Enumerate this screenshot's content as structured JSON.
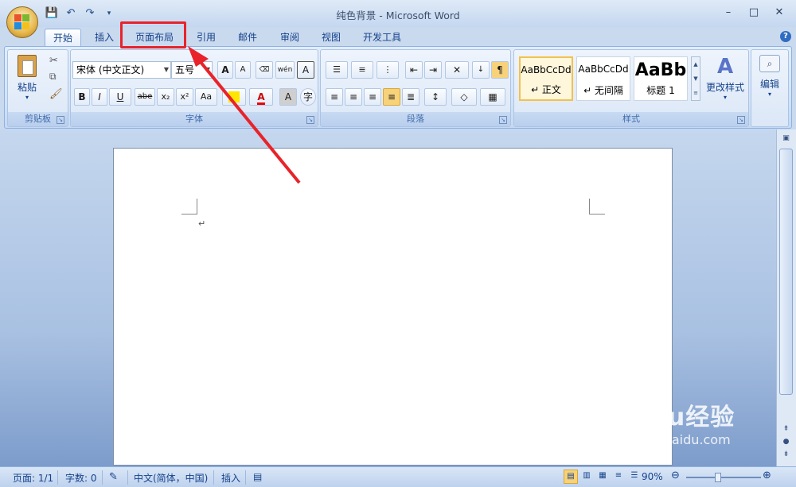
{
  "window": {
    "title": "纯色背景 - Microsoft Word",
    "controls": [
      "–",
      "□",
      "✕"
    ]
  },
  "tabs": [
    {
      "label": "开始",
      "active": true
    },
    {
      "label": "插入",
      "active": false
    },
    {
      "label": "页面布局",
      "active": false,
      "highlighted": true
    },
    {
      "label": "引用",
      "active": false
    },
    {
      "label": "邮件",
      "active": false
    },
    {
      "label": "审阅",
      "active": false
    },
    {
      "label": "视图",
      "active": false
    },
    {
      "label": "开发工具",
      "active": false
    }
  ],
  "ribbon": {
    "clipboard": {
      "label": "剪贴板",
      "paste_label": "粘贴"
    },
    "font": {
      "label": "字体",
      "font_name": "宋体 (中文正文)",
      "font_size": "五号",
      "format_buttons": [
        "B",
        "I",
        "U",
        "abe",
        "x₂",
        "x²",
        "Aa"
      ],
      "big_labels": [
        "A",
        "A",
        "wén",
        "A"
      ]
    },
    "paragraph": {
      "label": "段落"
    },
    "styles": {
      "label": "样式",
      "items": [
        {
          "sample": "AaBbCcDd",
          "name": "↵ 正文",
          "selected": true
        },
        {
          "sample": "AaBbCcDd",
          "name": "↵ 无间隔",
          "selected": false
        },
        {
          "sample": "AaBb",
          "name": "标题 1",
          "selected": false
        }
      ],
      "change_styles_label": "更改样式"
    },
    "editing": {
      "label": "编辑"
    }
  },
  "document": {
    "paragraph_mark": "↵"
  },
  "status": {
    "page": "页面: 1/1",
    "words": "字数: 0",
    "language": "中文(简体，中国)",
    "mode": "插入",
    "zoom": "90%"
  },
  "watermark": {
    "brand": "Baidu经验",
    "url": "jingyan.baidu.com"
  },
  "colors": {
    "highlight": "#e8232a",
    "accent": "#15428b"
  }
}
